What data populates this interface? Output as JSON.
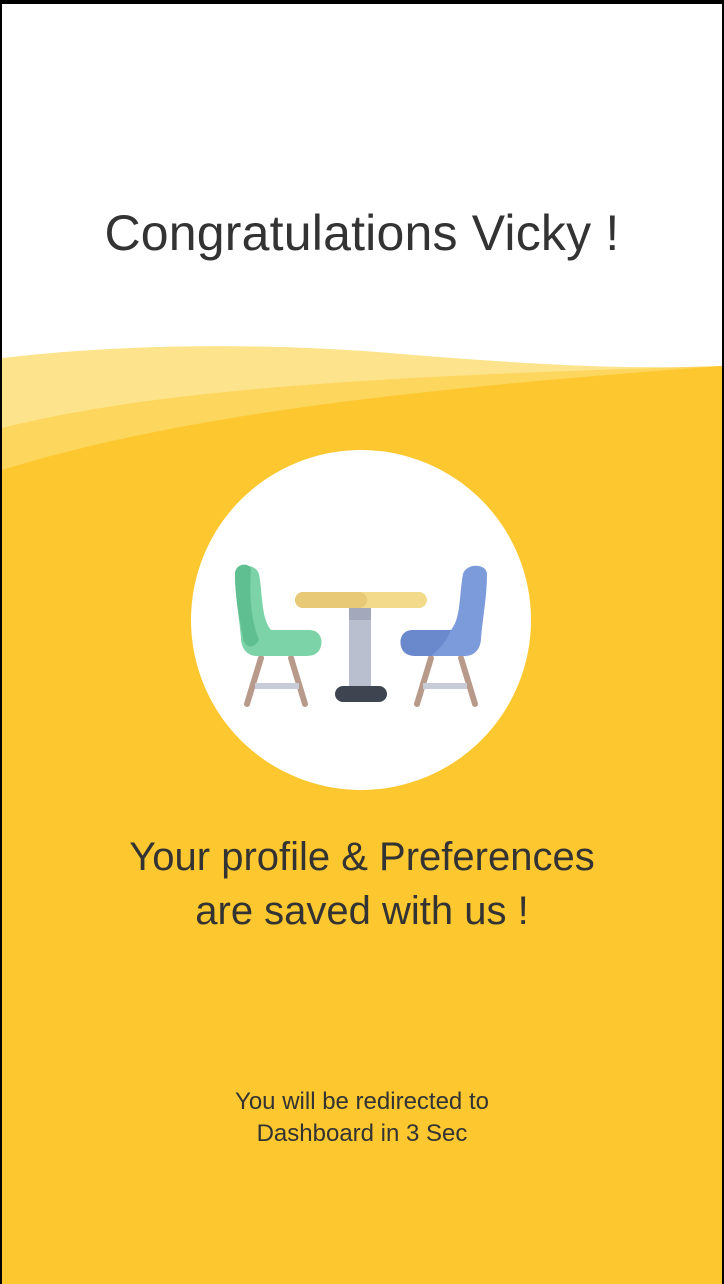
{
  "header": {
    "title": "Congratulations Vicky !"
  },
  "illustration": {
    "name": "table-and-chairs-icon",
    "colors": {
      "background": "#FDC82F",
      "wave_light": "#FDE48C",
      "wave_mid": "#FDD65E",
      "left_chair": "#7DD3A8",
      "right_chair": "#7B9BDB",
      "table_top": "#F2DA8A",
      "table_leg": "#B9BFCF",
      "table_base": "#3E4450",
      "chair_legs": "#B89A8A"
    }
  },
  "message": {
    "line1": "Your profile & Preferences",
    "line2": "are saved with us !"
  },
  "redirect": {
    "line1": "You will be redirected to",
    "line2": "Dashboard in 3 Sec"
  }
}
